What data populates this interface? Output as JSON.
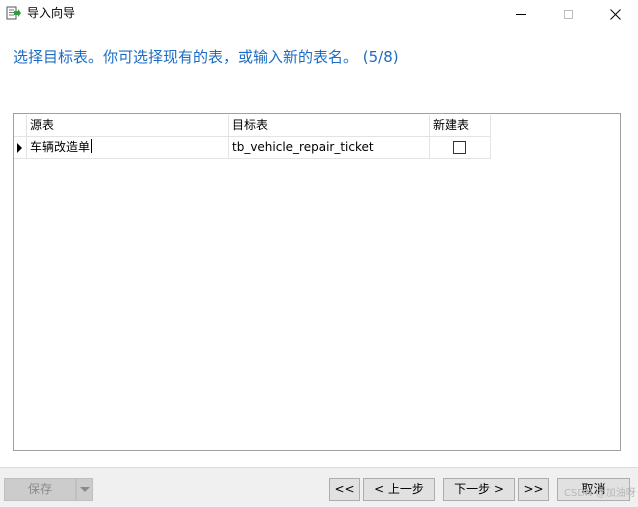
{
  "window": {
    "title": "导入向导",
    "icon": "import-wizard-icon"
  },
  "heading": "选择目标表。你可选择现有的表，或输入新的表名。 (5/8)",
  "grid": {
    "columns": [
      "源表",
      "目标表",
      "新建表"
    ],
    "rows": [
      {
        "source": "车辆改造单",
        "target": "tb_vehicle_repair_ticket",
        "new_table": false
      }
    ]
  },
  "footer": {
    "save_label": "保存",
    "first_label": "<<",
    "prev_label": "< 上一步",
    "next_label": "下一步 >",
    "last_label": ">>",
    "cancel_label": "取消"
  },
  "watermark": "CSDN @加油呀",
  "colors": {
    "heading": "#1c6cc4",
    "button_bg": "#e1e1e1",
    "disabled_bg": "#cccccc"
  }
}
